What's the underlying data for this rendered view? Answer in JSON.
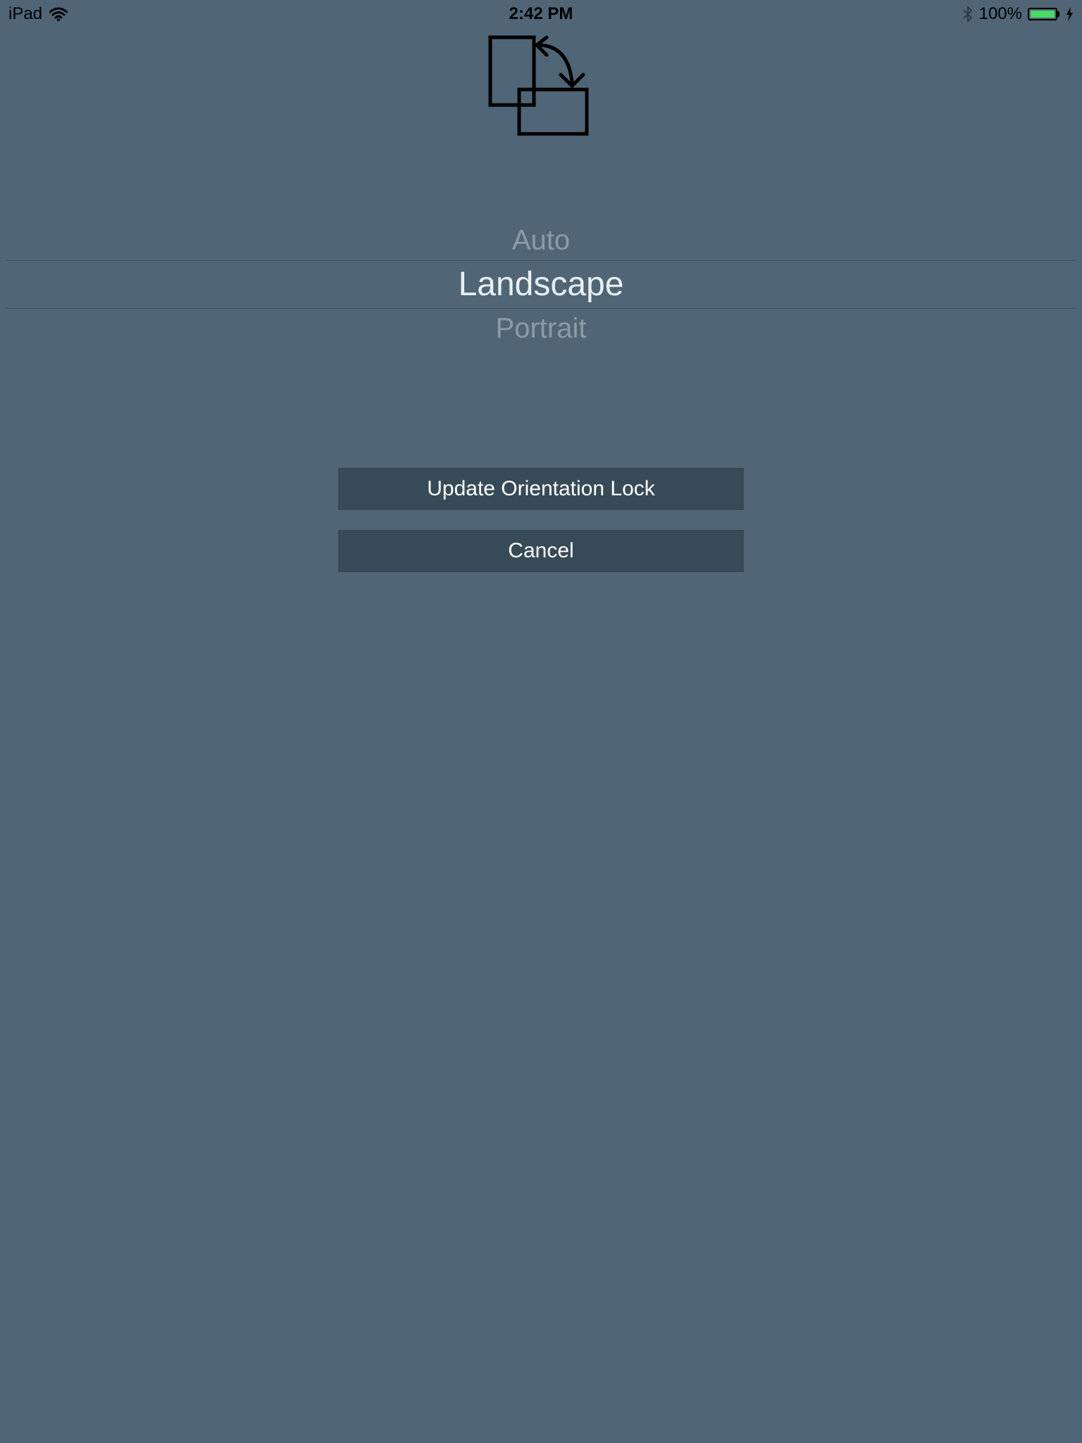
{
  "status_bar": {
    "device": "iPad",
    "time": "2:42 PM",
    "battery_percent": "100%",
    "battery_level": 1.0,
    "icons": [
      "wifi-icon",
      "bluetooth-icon",
      "battery-icon",
      "charging-icon"
    ],
    "battery_color": "#4cd964"
  },
  "header_icon": "orientation-rotate-icon",
  "picker": {
    "options": [
      "Auto",
      "Landscape",
      "Portrait"
    ],
    "selected": "Landscape"
  },
  "buttons": {
    "update_label": "Update Orientation Lock",
    "cancel_label": "Cancel"
  },
  "colors": {
    "background": "#506676",
    "button_background": "#374a57",
    "button_text": "#ffffff",
    "selected_option": "#e8eef2",
    "dim_option": "#8d9ba6"
  }
}
